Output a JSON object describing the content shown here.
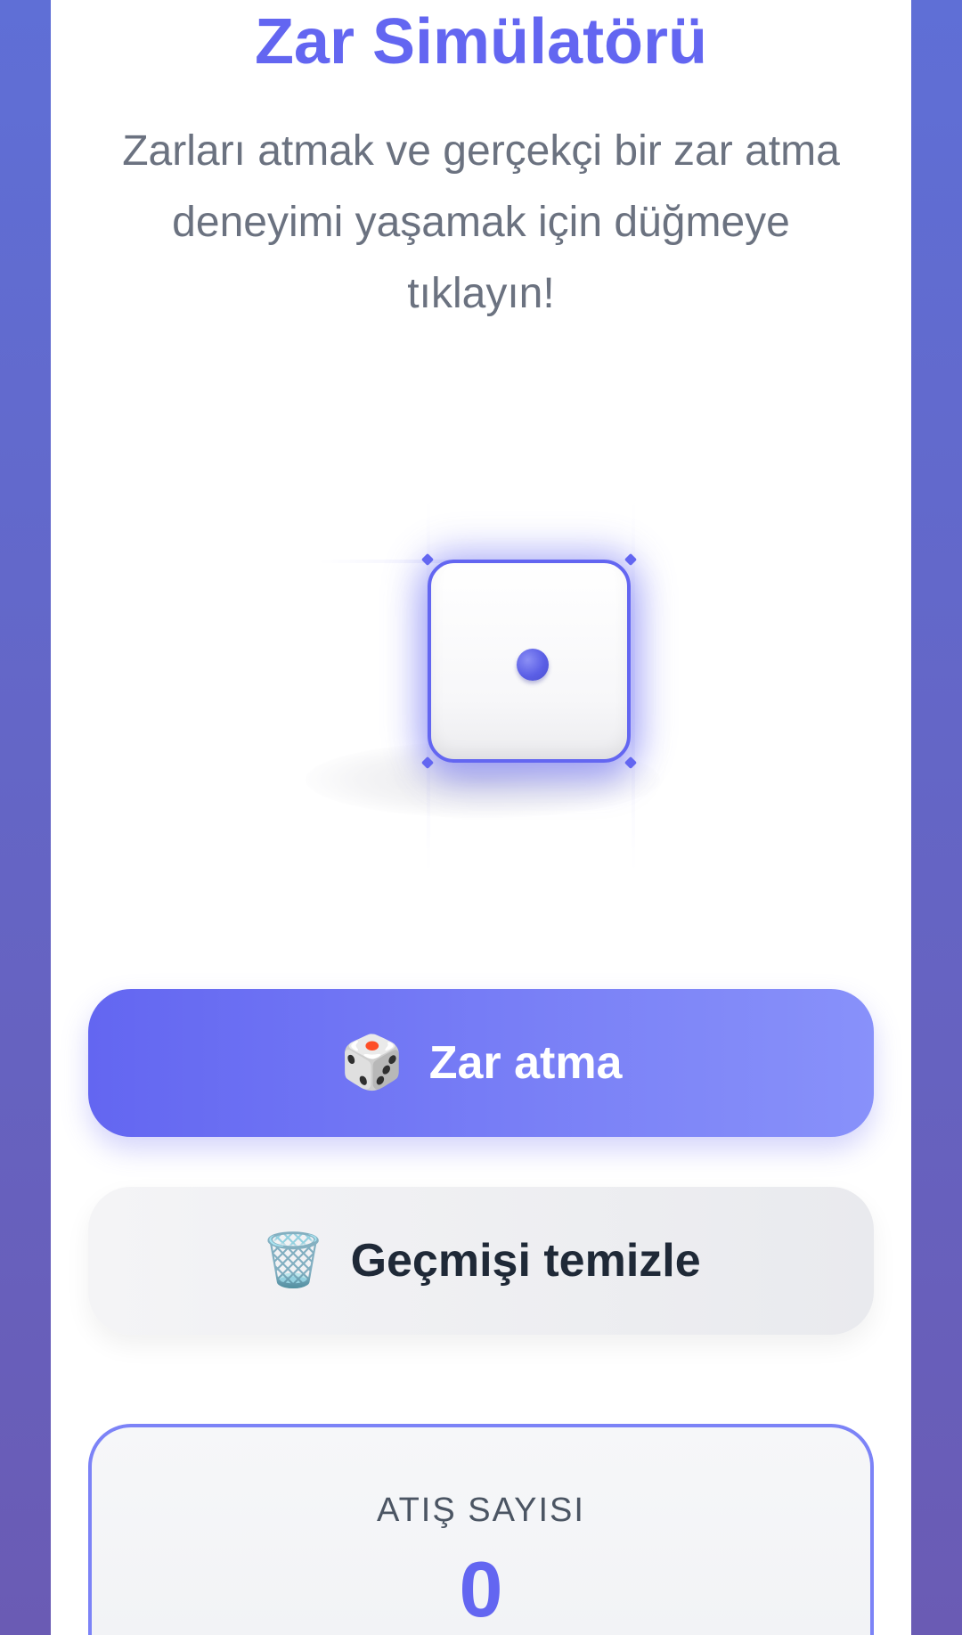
{
  "app": {
    "title": "Zar Simülatörü",
    "description": "Zarları atmak ve gerçekçi bir zar atma deneyimi yaşamak için düğmeye tıklayın!"
  },
  "dice": {
    "value": 1,
    "accent_color": "#6366f1"
  },
  "buttons": {
    "roll_icon": "🎲",
    "roll_label": "Zar atma",
    "clear_icon": "🗑️",
    "clear_label": "Geçmişi temizle"
  },
  "stats": {
    "label": "ATIŞ SAYISI",
    "value": "0"
  },
  "colors": {
    "background_gradient_start": "#5f6fd6",
    "background_gradient_end": "#6a5bb4",
    "accent": "#6366f1",
    "text_muted": "#6b7280",
    "text_dark": "#1f2937"
  }
}
